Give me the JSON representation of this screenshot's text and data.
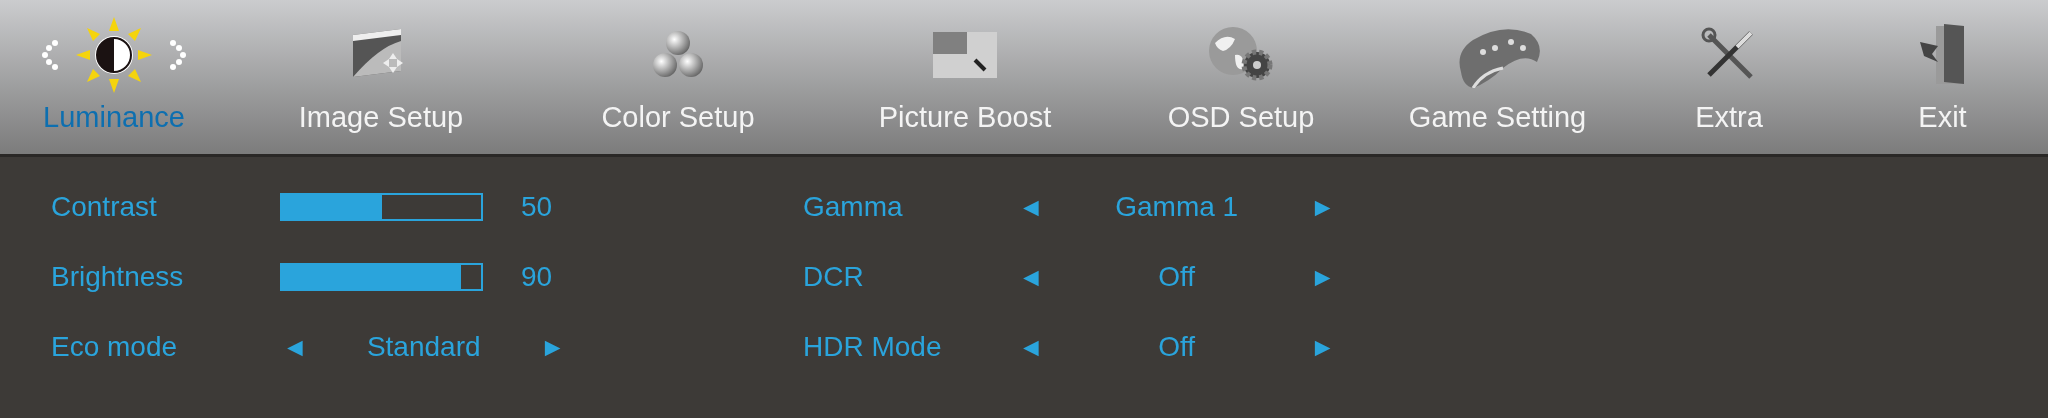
{
  "tabs": [
    {
      "label": "Luminance",
      "kind": "sun",
      "selected": true
    },
    {
      "label": "Image Setup",
      "kind": "image",
      "selected": false
    },
    {
      "label": "Color Setup",
      "kind": "balls",
      "selected": false
    },
    {
      "label": "Picture Boost",
      "kind": "boost",
      "selected": false
    },
    {
      "label": "OSD Setup",
      "kind": "globe",
      "selected": false
    },
    {
      "label": "Game Setting",
      "kind": "gamepad",
      "selected": false
    },
    {
      "label": "Extra",
      "kind": "tools",
      "selected": false
    },
    {
      "label": "Exit",
      "kind": "door",
      "selected": false
    }
  ],
  "columns": [
    [
      {
        "kind": "slider",
        "label": "Contrast",
        "level": 0.5,
        "reading": "50"
      },
      {
        "kind": "slider",
        "label": "Brightness",
        "level": 0.9,
        "reading": "90"
      },
      {
        "kind": "selector",
        "label": "Eco mode",
        "value": "Standard",
        "left": "◄",
        "right": "►"
      }
    ],
    [
      {
        "kind": "selector",
        "label": "Gamma",
        "value": "Gamma 1",
        "left": "◄",
        "right": "►"
      },
      {
        "kind": "selector",
        "label": "DCR",
        "value": "Off",
        "left": "◄",
        "right": "►"
      },
      {
        "kind": "selector",
        "label": "HDR Mode",
        "value": "Off",
        "left": "◄",
        "right": "►"
      }
    ]
  ]
}
